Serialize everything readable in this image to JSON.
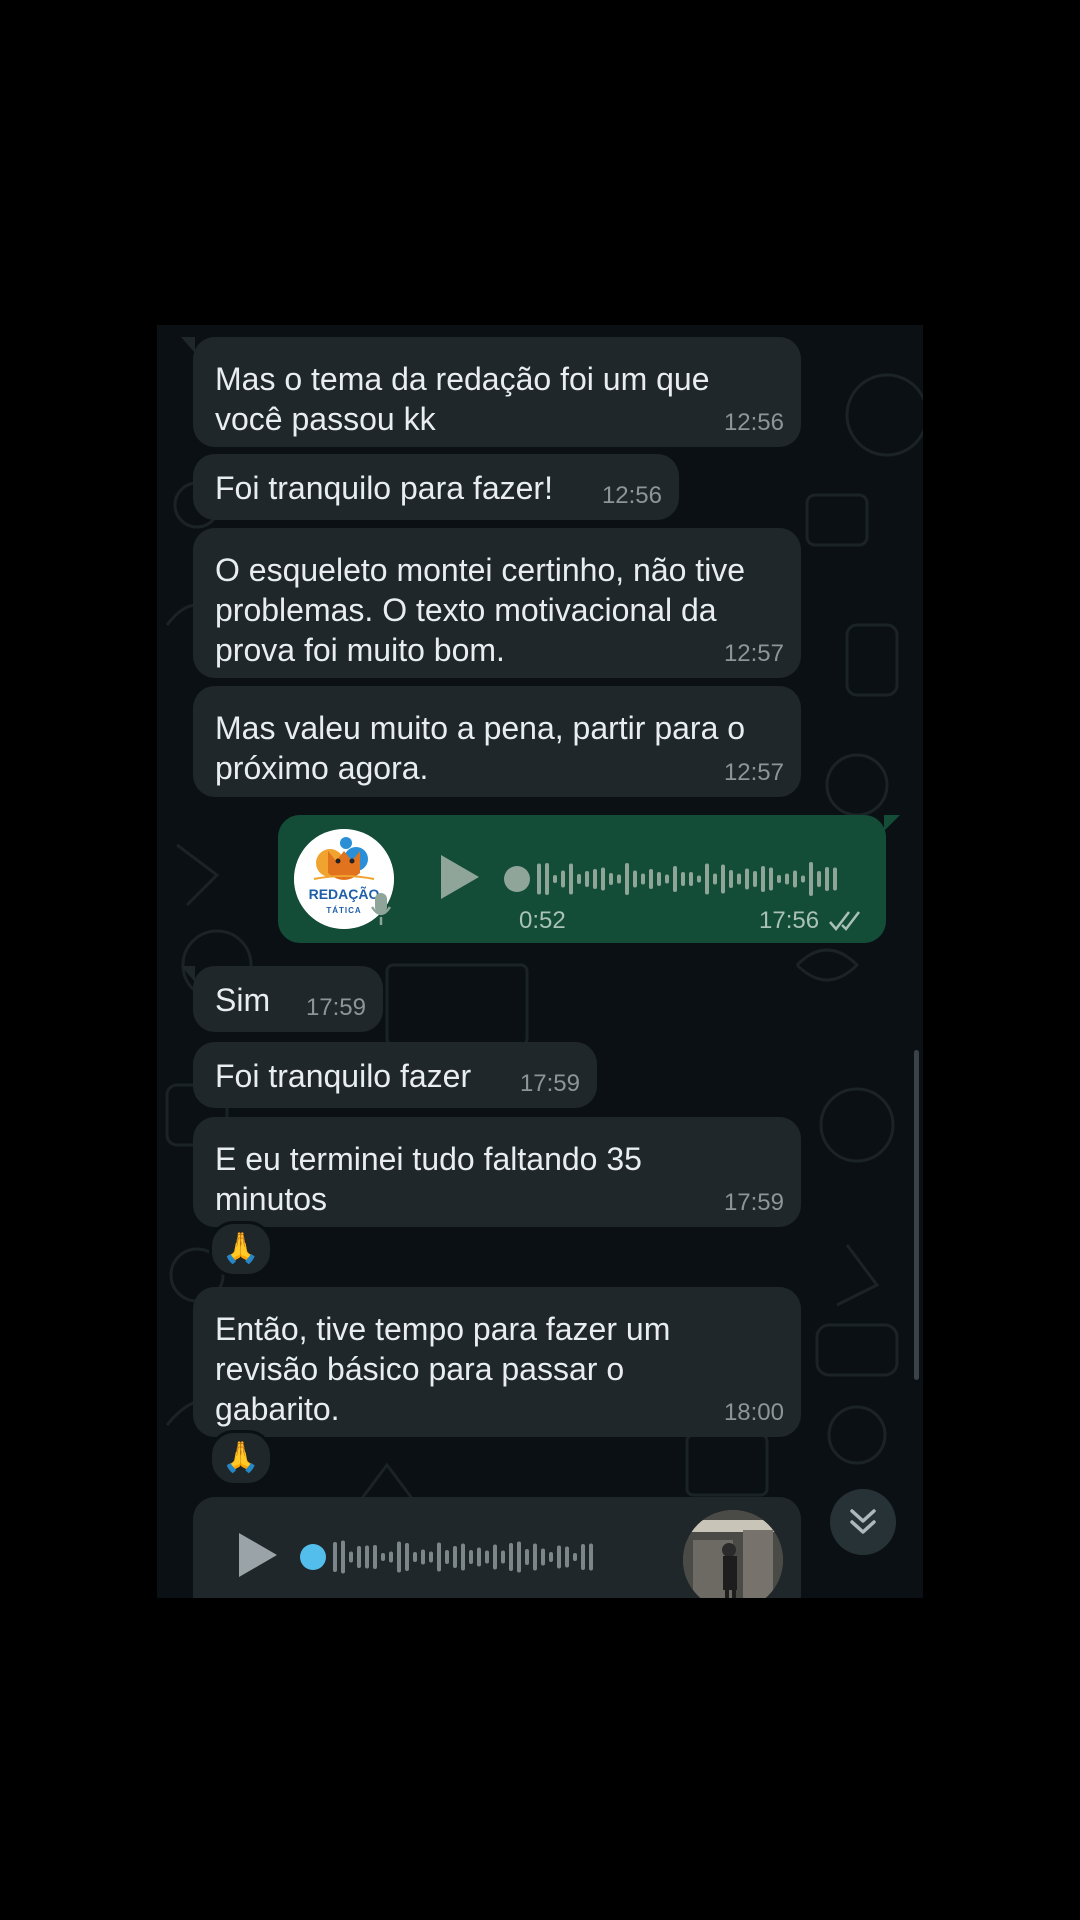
{
  "messages": [
    {
      "text": "Mas o tema da redação foi um que\nvocê passou kk",
      "time": "12:56"
    },
    {
      "text": "Foi tranquilo para fazer!",
      "time": "12:56"
    },
    {
      "text": "O esqueleto montei certinho, não tive\nproblemas. O texto motivacional da\nprova foi muito bom.",
      "time": "12:57"
    },
    {
      "text": "Mas valeu muito a pena, partir para o\npróximo agora.",
      "time": "12:57"
    },
    {
      "text": "Sim",
      "time": "17:59"
    },
    {
      "text": "Foi tranquilo fazer",
      "time": "17:59"
    },
    {
      "text": "E eu terminei tudo faltando 35\nminutos",
      "time": "17:59",
      "reaction": "🙏"
    },
    {
      "text": "Então, tive tempo para fazer um\nrevisão básico para passar o\ngabarito.",
      "time": "18:00",
      "reaction": "🙏"
    }
  ],
  "voice_out": {
    "duration": "0:52",
    "time": "17:56",
    "status": "read",
    "avatar_line1": "REDAÇÃO",
    "avatar_line2": "TÁTICA"
  },
  "voice_in": {
    "progress": 0
  },
  "icons": {
    "play": "play-icon",
    "mic": "mic-icon",
    "read_receipt": "double-check-icon",
    "scroll_down": "chevrons-down-icon",
    "reaction": "folded-hands-emoji"
  },
  "colors": {
    "background": "#0b1014",
    "incoming_bubble": "#1f272a",
    "outgoing_bubble": "#144d37",
    "text": "#e9edef",
    "meta": "#8d9599",
    "playhead": "#53bdeb"
  }
}
